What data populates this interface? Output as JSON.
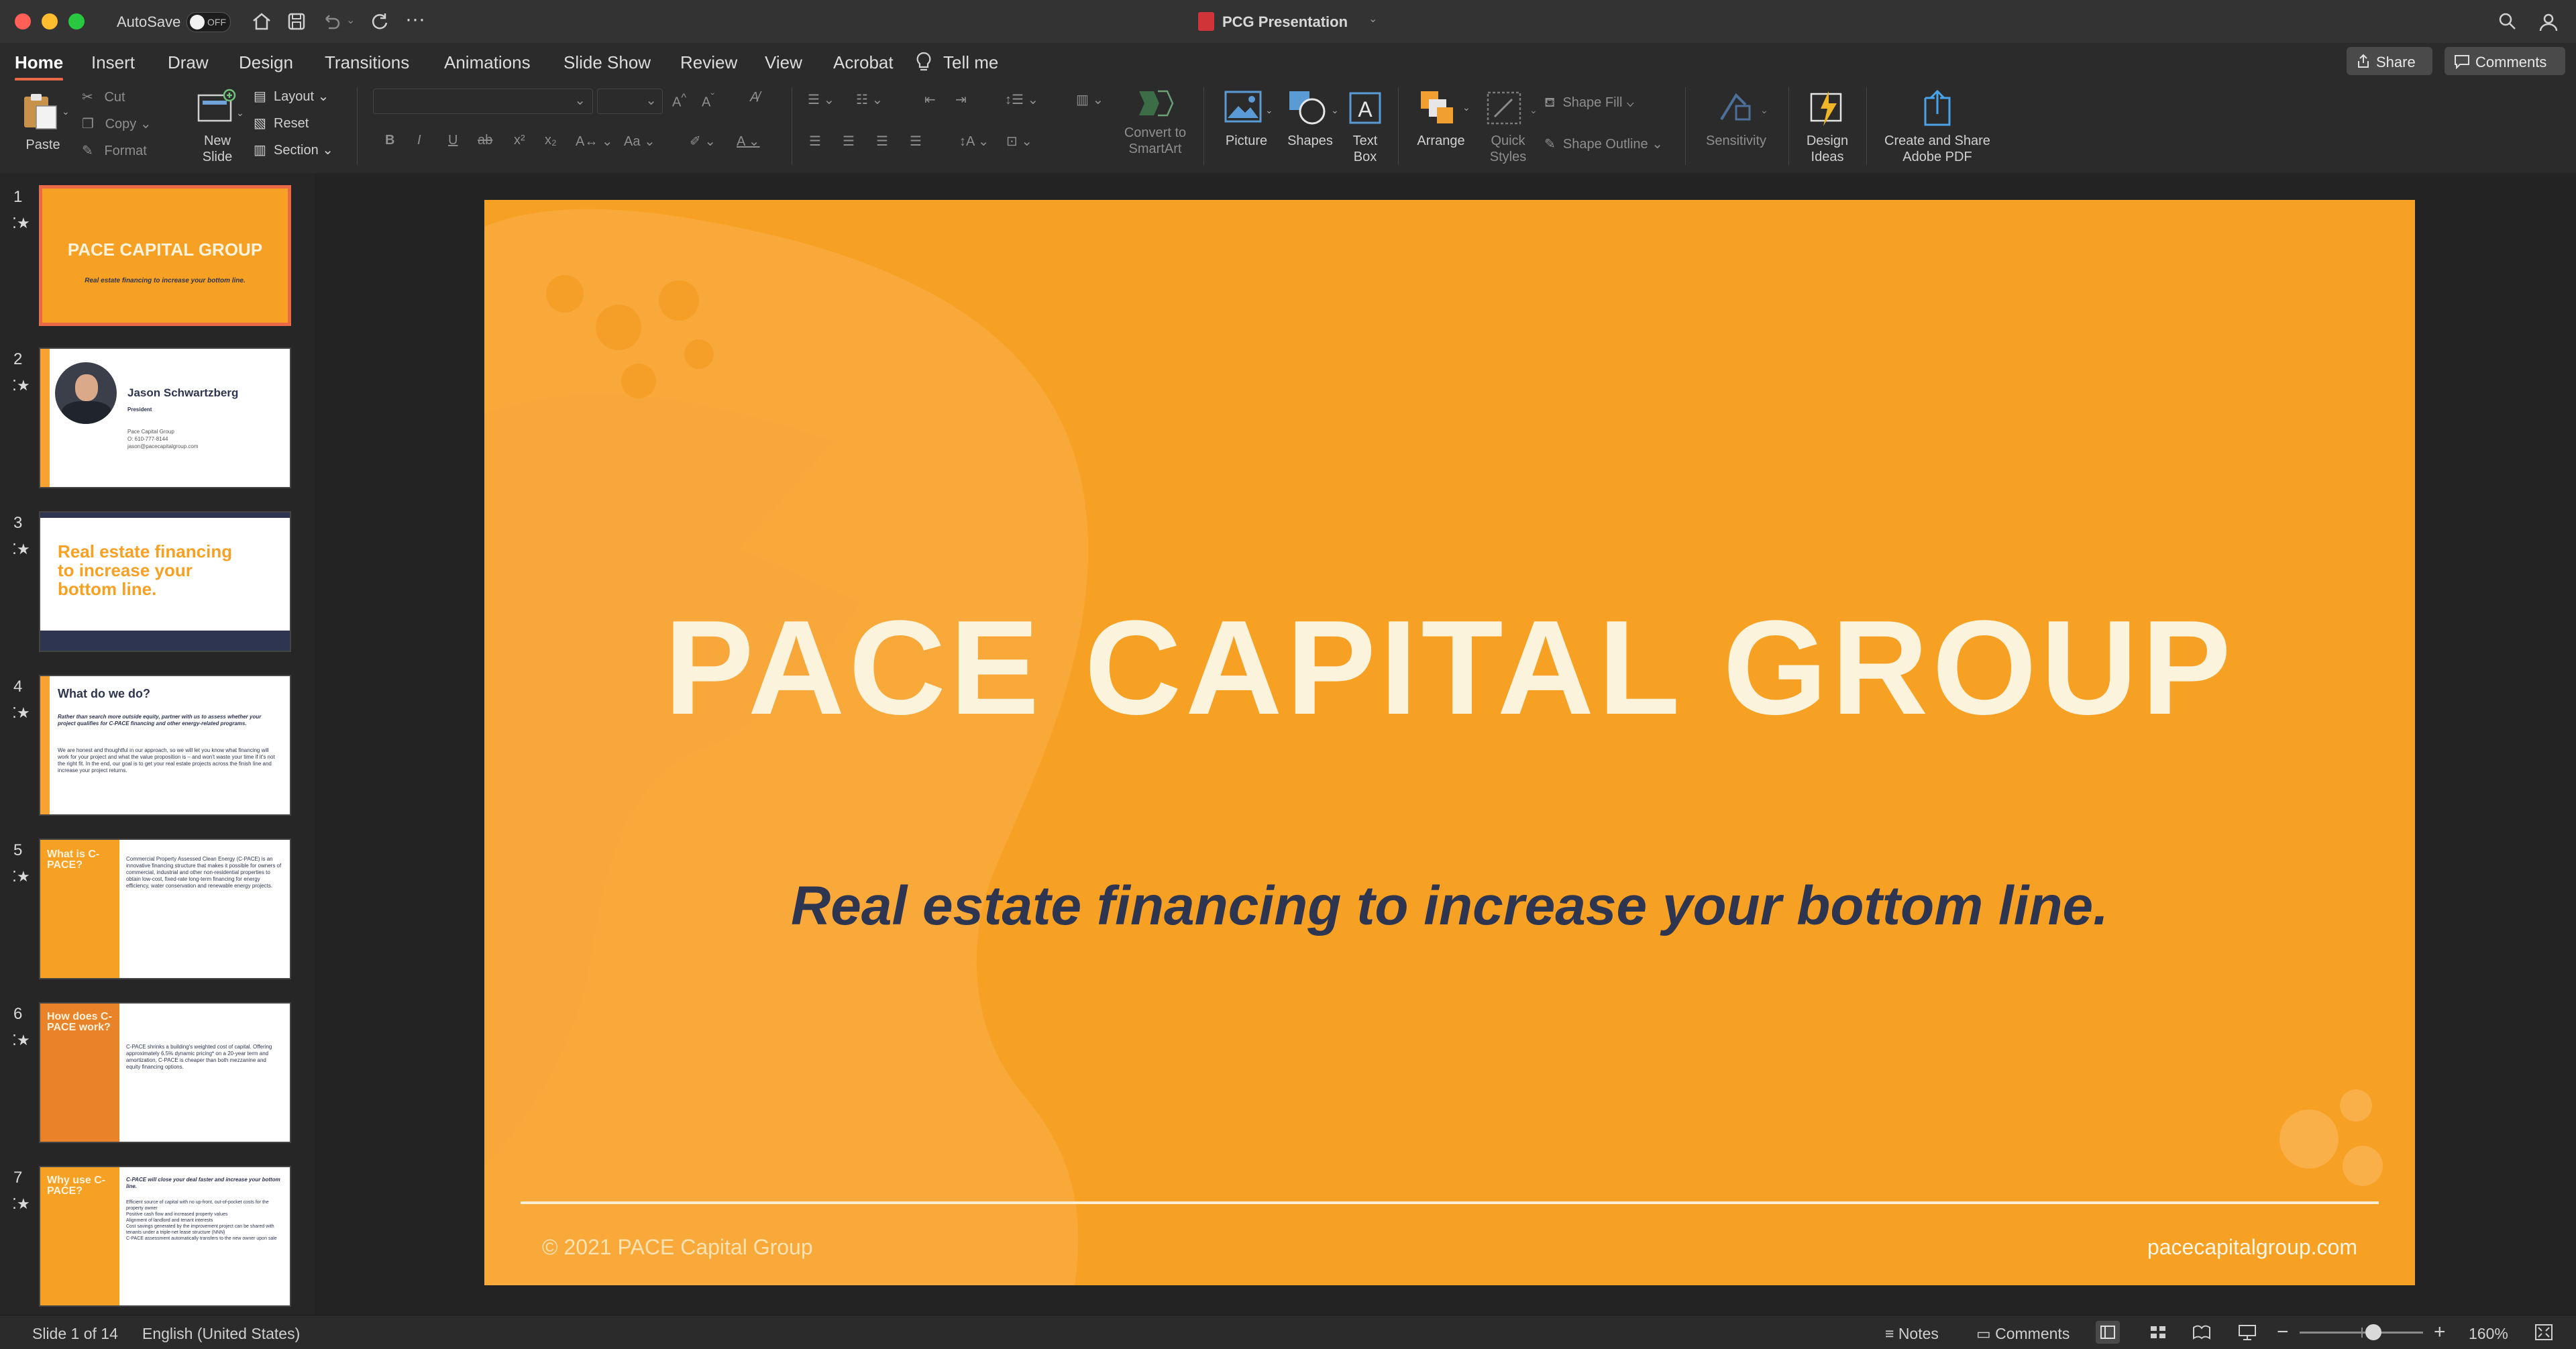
{
  "window": {
    "title": "PCG Presentation",
    "autosave_label": "AutoSave",
    "autosave_state": "OFF"
  },
  "tabs": [
    "Home",
    "Insert",
    "Draw",
    "Design",
    "Transitions",
    "Animations",
    "Slide Show",
    "Review",
    "View",
    "Acrobat"
  ],
  "tell_me": "Tell me",
  "actions": {
    "share": "Share",
    "comments": "Comments"
  },
  "ribbon": {
    "paste": "Paste",
    "cut": "Cut",
    "copy": "Copy",
    "format": "Format",
    "new_slide": [
      "New",
      "Slide"
    ],
    "layout": "Layout",
    "reset": "Reset",
    "section": "Section",
    "convert_smartart": [
      "Convert to",
      "SmartArt"
    ],
    "picture": "Picture",
    "shapes": "Shapes",
    "textbox": [
      "Text",
      "Box"
    ],
    "arrange": "Arrange",
    "quick_styles": [
      "Quick",
      "Styles"
    ],
    "shape_fill": "Shape Fill",
    "shape_outline": "Shape Outline",
    "sensitivity": "Sensitivity",
    "design_ideas": [
      "Design",
      "Ideas"
    ],
    "adobe_pdf": [
      "Create and Share",
      "Adobe PDF"
    ]
  },
  "thumbnails": [
    {
      "num": "1",
      "title": "PACE CAPITAL GROUP",
      "body": "Real estate financing to increase your bottom line."
    },
    {
      "num": "2",
      "title": "Jason Schwartzberg",
      "body": "President",
      "small": [
        "Pace Capital Group",
        "O: 610-777-8144",
        "jason@pacecapitalgroup.com"
      ]
    },
    {
      "num": "3",
      "title": "Real estate financing to increase your bottom line."
    },
    {
      "num": "4",
      "title": "What do we do?",
      "body": "Rather than search more outside equity, partner with us to assess whether your project qualifies for C-PACE financing and other energy-related programs.",
      "small": [
        "We are honest and thoughtful in our approach, so we will let you know what financing will work for your project and what the value proposition is – and won't waste your time if it's not the right fit. In the end, our goal is to get your real estate projects across the finish line and increase your project returns."
      ]
    },
    {
      "num": "5",
      "title": "What is C-PACE?",
      "body": "Commercial Property Assessed Clean Energy (C-PACE) is an innovative financing structure that makes it possible for owners of commercial, industrial and other non-residential properties to obtain low-cost, fixed-rate long-term financing for energy efficiency, water conservation and renewable energy projects."
    },
    {
      "num": "6",
      "title": "How does C-PACE work?",
      "body": "C-PACE shrinks a building's weighted cost of capital. Offering approximately 6.5% dynamic pricing* on a 20-year term and amortization, C-PACE is cheaper than both mezzanine and equity financing options."
    },
    {
      "num": "7",
      "title": "Why use C-PACE?",
      "body": "C-PACE will close your deal faster and increase your bottom line.",
      "small": [
        "Efficient source of capital with no up-front, out-of-pocket costs for the property owner",
        "Positive cash flow and increased property values",
        "Alignment of landlord and tenant interests",
        "Cost savings generated by the improvement project can be shared with tenants under a triple-net lease structure (NNN)",
        "C-PACE assessment automatically transfers to the new owner upon sale"
      ]
    }
  ],
  "slide": {
    "title": "PACE CAPITAL GROUP",
    "subtitle": "Real estate financing to increase your bottom line.",
    "copyright": "© 2021 PACE Capital Group",
    "url": "pacecapitalgroup.com"
  },
  "status": {
    "slide_counter": "Slide 1 of 14",
    "language": "English (United States)",
    "notes": "Notes",
    "comments": "Comments",
    "zoom": "160%"
  },
  "colors": {
    "accent": "#ea6a47",
    "slide_orange": "#f7a124",
    "slide_navy": "#2e3550"
  }
}
